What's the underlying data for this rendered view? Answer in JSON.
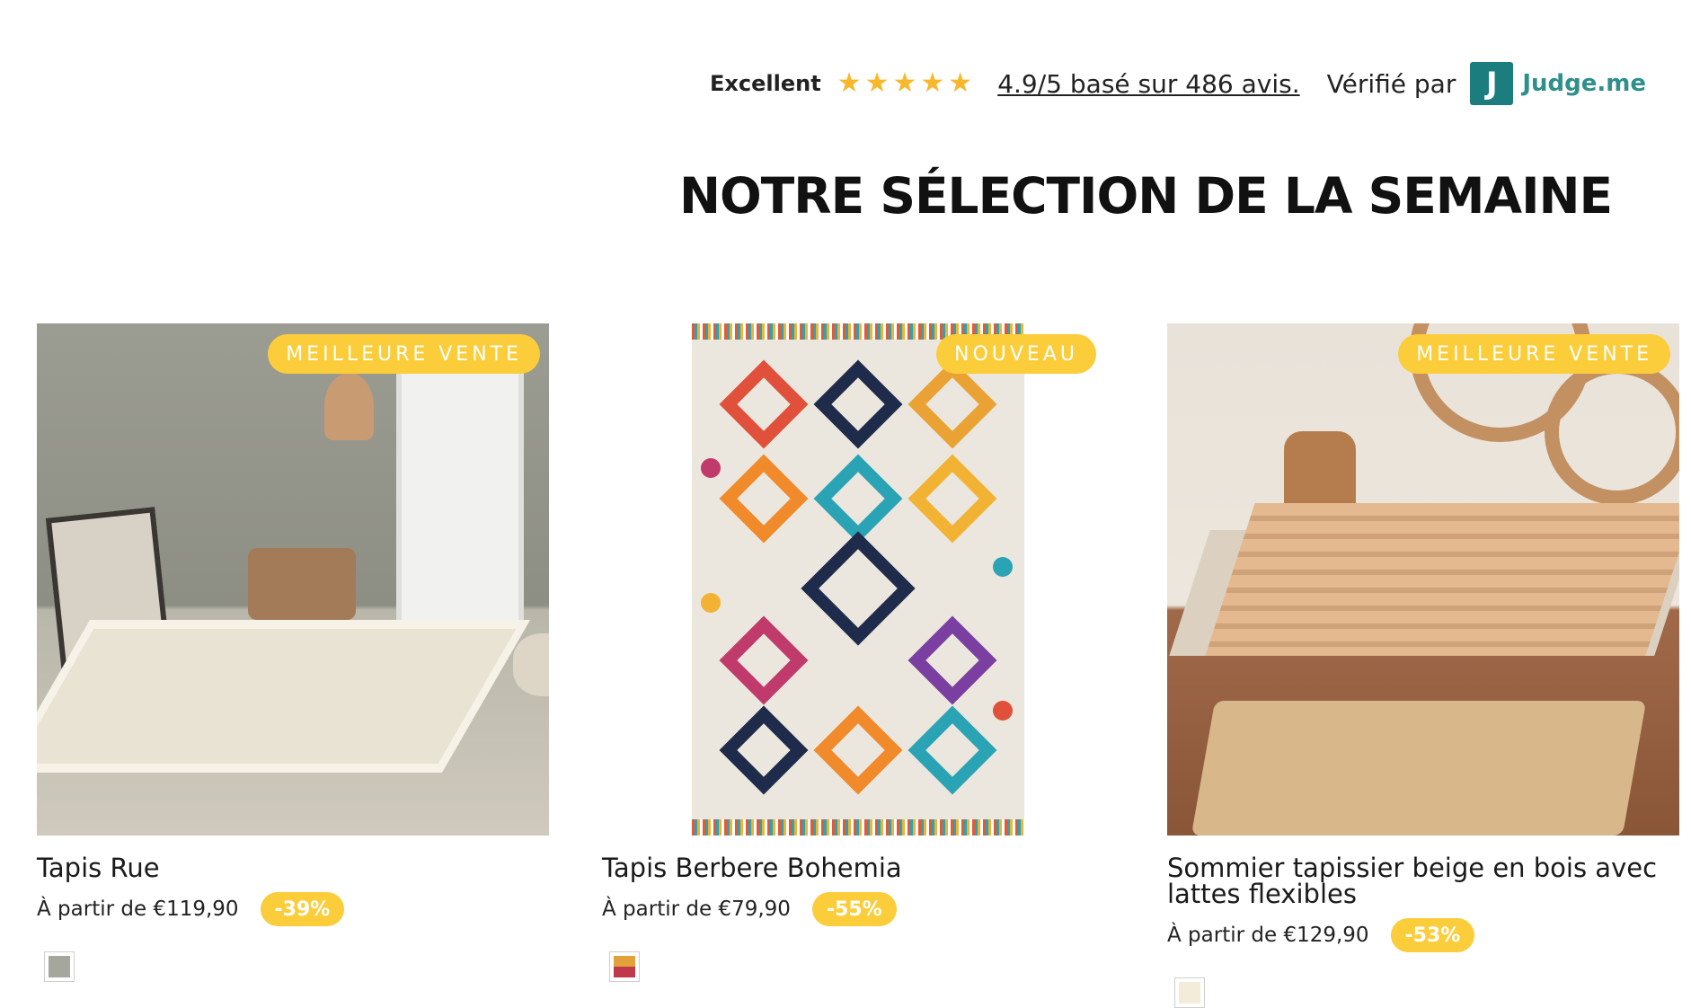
{
  "reviews": {
    "rating_label": "Excellent",
    "star_count": 5,
    "summary_link": "4.9/5 basé sur 486 avis.",
    "verified_by": "Vérifié par",
    "provider_logo_letter": "J",
    "provider_name": "Judge.me"
  },
  "heading": "NOTRE SÉLECTION DE LA SEMAINE",
  "products": [
    {
      "badge": "MEILLEURE VENTE",
      "title": "Tapis Rue",
      "price": "À partir de €119,90",
      "discount": "-39%",
      "swatch_color": "#a5a79c"
    },
    {
      "badge": "NOUVEAU",
      "title": "Tapis Berbere Bohemia",
      "price": "À partir de €79,90",
      "discount": "-55%",
      "swatch_color": "#d6553a"
    },
    {
      "badge": "MEILLEURE VENTE",
      "title": "Sommier tapissier beige en bois avec lattes flexibles",
      "price": "À partir de €129,90",
      "discount": "-53%",
      "swatch_color": "#f3ecd8"
    }
  ],
  "colors": {
    "accent_badge": "#fccd3a",
    "star": "#f7b82b",
    "judgeme_teal": "#1c7d7f"
  }
}
